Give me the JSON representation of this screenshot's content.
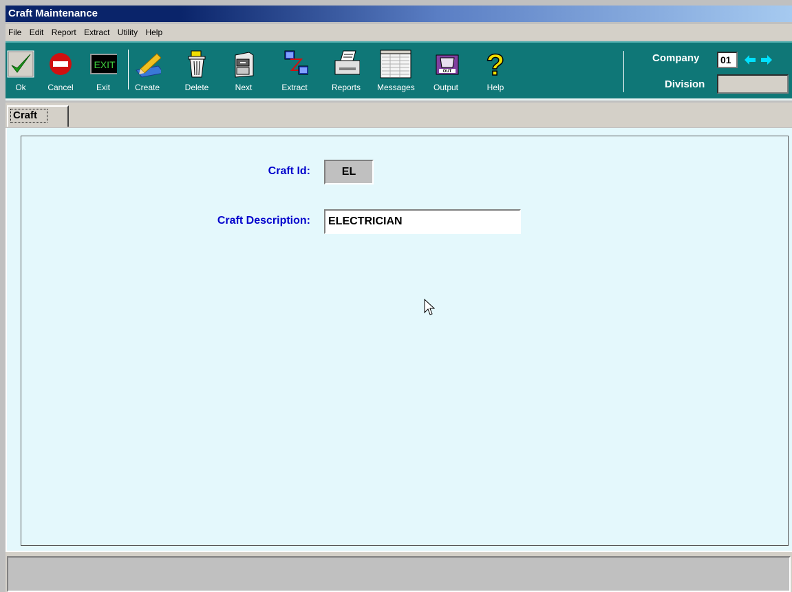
{
  "window": {
    "title": "Craft Maintenance"
  },
  "menu": [
    "File",
    "Edit",
    "Report",
    "Extract",
    "Utility",
    "Help"
  ],
  "toolbar": {
    "ok": "Ok",
    "cancel": "Cancel",
    "exit": "Exit",
    "exit_sign": "EXIT",
    "create": "Create",
    "delete": "Delete",
    "next": "Next",
    "extract": "Extract",
    "reports": "Reports",
    "messages": "Messages",
    "output": "Output",
    "help": "Help"
  },
  "company": {
    "label": "Company",
    "value": "01"
  },
  "division": {
    "label": "Division",
    "value": ""
  },
  "tabs": [
    {
      "label": "Craft",
      "active": true
    }
  ],
  "form": {
    "craft_id_label": "Craft Id:",
    "craft_id_value": "EL",
    "craft_description_label": "Craft Description:",
    "craft_description_value": "ELECTRICIAN"
  },
  "status": {
    "text": ""
  }
}
